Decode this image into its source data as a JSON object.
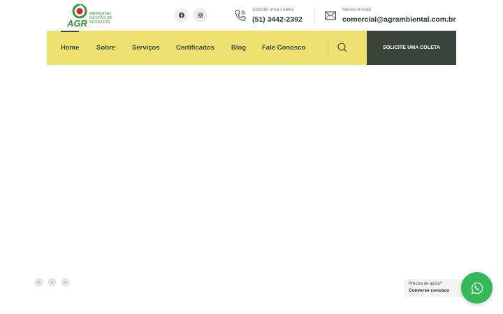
{
  "brand": {
    "logo_letters": "AGR",
    "logo_tagline": "AMBIENTAL GESTÃO DE RESÍDUOS"
  },
  "social": {
    "facebook_icon": "facebook-icon",
    "instagram_icon": "instagram-icon"
  },
  "contacts": {
    "phone": {
      "label": "Solicite uma coleta",
      "value": "(51) 3442-2392",
      "icon": "phone-icon"
    },
    "email": {
      "label": "Nosso e-mail",
      "value": "comercial@agrambiental.com.br",
      "icon": "mail-icon"
    }
  },
  "nav": {
    "items": [
      {
        "label": "Home",
        "active": true
      },
      {
        "label": "Sobre"
      },
      {
        "label": "Serviços"
      },
      {
        "label": "Certificados"
      },
      {
        "label": "Blog"
      },
      {
        "label": "Fale Conosco"
      }
    ],
    "search_icon": "search-icon",
    "cta_label": "SOLICITE UMA COLETA"
  },
  "slider": {
    "dots": 3,
    "active_index": 0
  },
  "chat": {
    "prompt": "Precisa de ajuda?",
    "cta": "Converse conosco",
    "icon": "whatsapp-icon"
  },
  "colors": {
    "nav_bg": "#ede170",
    "cta_bg": "#3a463b",
    "brand_green": "#3a8f3a",
    "brand_red": "#d2232a",
    "whatsapp_green": "#33b85a"
  }
}
